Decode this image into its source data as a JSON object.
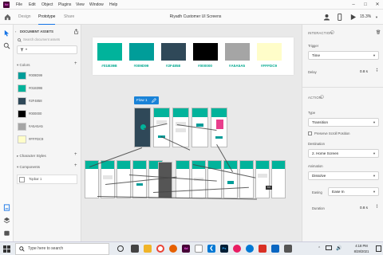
{
  "menu": [
    "File",
    "Edit",
    "Object",
    "Plugins",
    "View",
    "Window",
    "Help"
  ],
  "app": {
    "logo": "Xd",
    "tabs": {
      "design": "Design",
      "prototype": "Prototype",
      "share": "Share"
    },
    "doc_title": "Riyadh Customer UI Screens",
    "zoom": "15.3%"
  },
  "assets": {
    "header": "DOCUMENT ASSETS",
    "search_placeholder": "Search document assets",
    "colors_label": "Colors",
    "colors": [
      {
        "label": "#009D99",
        "hex": "#009d99"
      },
      {
        "label": "#01B39B",
        "hex": "#01b39b"
      },
      {
        "label": "#2F4858",
        "hex": "#2f4858"
      },
      {
        "label": "#000000",
        "hex": "#000000"
      },
      {
        "label": "#A5A5A5",
        "hex": "#a5a5a5"
      },
      {
        "label": "#FFFDC9",
        "hex": "#fffdc9"
      }
    ],
    "char_styles_label": "Character Styles",
    "components_label": "Components",
    "component_item": "Topbar 1"
  },
  "palette": [
    {
      "label": "#01B39B",
      "hex": "#01b39b"
    },
    {
      "label": "#009D99",
      "hex": "#009d99"
    },
    {
      "label": "#2F4858",
      "hex": "#2f4858"
    },
    {
      "label": "#000000",
      "hex": "#000000"
    },
    {
      "label": "#A5A5A5",
      "hex": "#a5a5a5"
    },
    {
      "label": "#FFFDC9",
      "hex": "#fffdc9"
    }
  ],
  "canvas": {
    "flow_label": "Flow 1",
    "tooltip": "Trir"
  },
  "props": {
    "interaction_title": "INTERACTION",
    "trigger_label": "Trigger",
    "trigger_value": "Time",
    "delay_label": "Delay",
    "delay_value": "0.8 s",
    "action_title": "ACTION",
    "type_label": "Type",
    "type_value": "Transition",
    "preserve_scroll": "Preserve Scroll Position",
    "destination_label": "Destination",
    "destination_value": "2. Home Screen",
    "animation_label": "Animation",
    "animation_value": "Dissolve",
    "easing_label": "Easing",
    "easing_value": "Ease In",
    "duration_label": "Duration",
    "duration_value": "0.8 s"
  },
  "taskbar": {
    "search_placeholder": "Type here to search",
    "time": "4:18 PM",
    "date": "8/28/2021"
  }
}
